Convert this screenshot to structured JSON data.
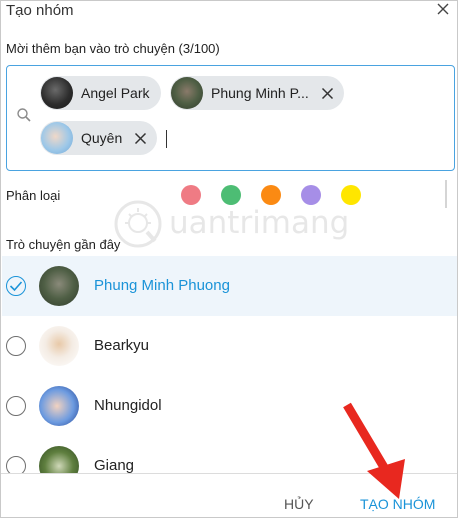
{
  "window": {
    "title": "Tạo nhóm"
  },
  "invite": {
    "label": "Mời thêm bạn vào trò chuyện (3/100)",
    "chips": [
      {
        "name": "Angel Park"
      },
      {
        "name": "Phung Minh P..."
      },
      {
        "name": "Quyên"
      }
    ]
  },
  "category": {
    "label": "Phân loại",
    "colors": [
      "#ef7b84",
      "#4dbd74",
      "#fb8a13",
      "#a68ee7",
      "#ffe600"
    ]
  },
  "recent": {
    "label": "Trò chuyện gần đây",
    "contacts": [
      {
        "name": "Phung Minh Phuong",
        "selected": true
      },
      {
        "name": "Bearkyu",
        "selected": false
      },
      {
        "name": "Nhungidol",
        "selected": false
      },
      {
        "name": "Giang",
        "selected": false
      }
    ]
  },
  "footer": {
    "cancel_label": "HỦY",
    "create_label": "TẠO NHÓM"
  },
  "watermark": {
    "text": "uantrimang"
  },
  "colors": {
    "accent": "#1a93d8",
    "selected_row": "#eef5fb",
    "arrow": "#e8281f"
  }
}
